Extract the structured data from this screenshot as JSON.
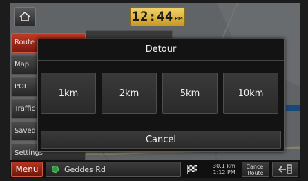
{
  "header": {
    "time": "12:44",
    "ampm": "PM"
  },
  "left_menu": {
    "items": [
      {
        "label": "Route",
        "active": true
      },
      {
        "label": "Map",
        "active": false
      },
      {
        "label": "POI",
        "active": false
      },
      {
        "label": "Traffic",
        "active": false
      },
      {
        "label": "Saved",
        "active": false
      },
      {
        "label": "Settings",
        "active": false
      }
    ]
  },
  "dialog": {
    "title": "Detour",
    "options": [
      "1km",
      "2km",
      "5km",
      "10km"
    ],
    "cancel_label": "Cancel"
  },
  "bottom_bar": {
    "menu_label": "Menu",
    "street": "Geddes Rd",
    "distance": "30.1 km",
    "eta": "1:12 PM",
    "cancel_route_line1": "Cancel",
    "cancel_route_line2": "Route"
  },
  "colors": {
    "accent_red": "#b63520",
    "clock_gold": "#e0b53d",
    "route_blue": "#2a7fd4",
    "street_dot_green": "#2f9a3a"
  },
  "icons": {
    "home": "home-icon",
    "destination": "checkered-flag-icon",
    "exit": "exit-arrow-icon"
  }
}
